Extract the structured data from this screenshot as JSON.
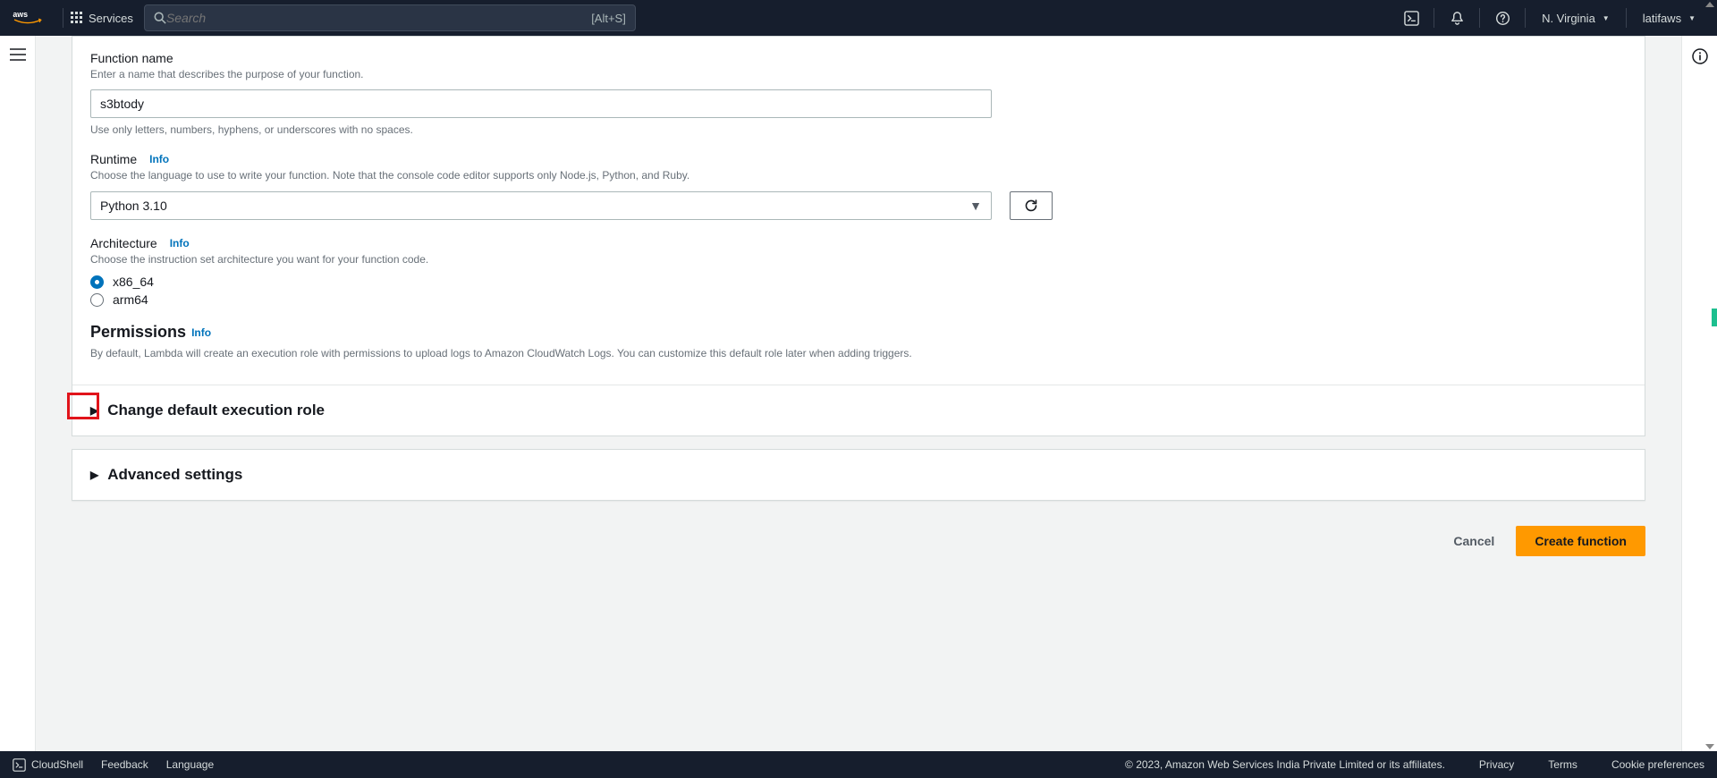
{
  "navbar": {
    "services_label": "Services",
    "search_placeholder": "Search",
    "search_shortcut": "[Alt+S]",
    "region": "N. Virginia",
    "user": "latifaws"
  },
  "form": {
    "function_name": {
      "label": "Function name",
      "desc": "Enter a name that describes the purpose of your function.",
      "value": "s3btody",
      "hint": "Use only letters, numbers, hyphens, or underscores with no spaces."
    },
    "runtime": {
      "label": "Runtime",
      "info": "Info",
      "desc": "Choose the language to use to write your function. Note that the console code editor supports only Node.js, Python, and Ruby.",
      "value": "Python 3.10"
    },
    "architecture": {
      "label": "Architecture",
      "info": "Info",
      "desc": "Choose the instruction set architecture you want for your function code.",
      "option_x86": "x86_64",
      "option_arm": "arm64"
    },
    "permissions": {
      "label": "Permissions",
      "info": "Info",
      "desc": "By default, Lambda will create an execution role with permissions to upload logs to Amazon CloudWatch Logs. You can customize this default role later when adding triggers."
    }
  },
  "expanders": {
    "execution_role": "Change default execution role",
    "advanced": "Advanced settings"
  },
  "actions": {
    "cancel": "Cancel",
    "create": "Create function"
  },
  "footer": {
    "cloudshell": "CloudShell",
    "feedback": "Feedback",
    "language": "Language",
    "copyright": "© 2023, Amazon Web Services India Private Limited or its affiliates.",
    "privacy": "Privacy",
    "terms": "Terms",
    "cookies": "Cookie preferences"
  }
}
